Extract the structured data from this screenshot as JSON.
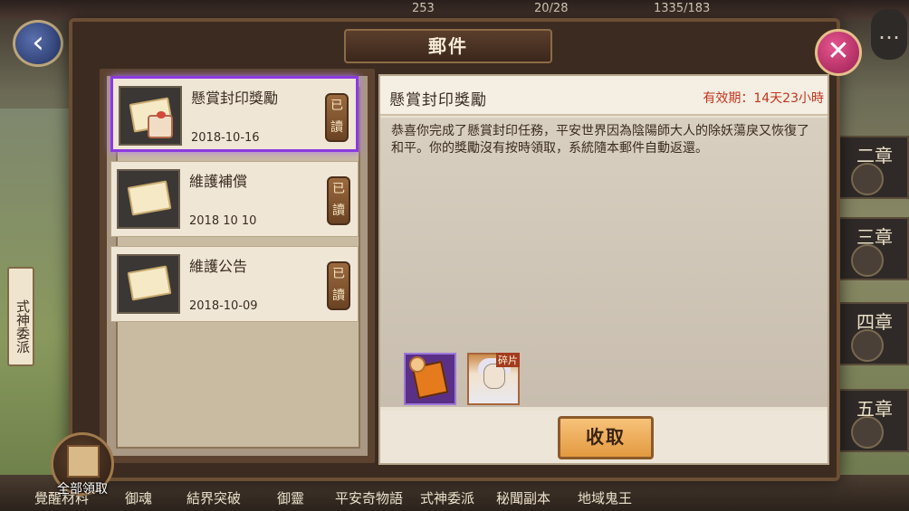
{
  "modal": {
    "title": "郵件",
    "close_icon": "close-icon"
  },
  "mail_list": [
    {
      "title": "懸賞封印獎勵",
      "date": "2018-10-16",
      "status": [
        "已",
        "讀"
      ],
      "icon": "gift-envelope-icon",
      "selected": true
    },
    {
      "title": "維護補償",
      "date": "2018 10 10",
      "status": [
        "已",
        "讀"
      ],
      "icon": "envelope-icon",
      "selected": false
    },
    {
      "title": "維護公告",
      "date": "2018-10-09",
      "status": [
        "已",
        "讀"
      ],
      "icon": "envelope-icon",
      "selected": false
    }
  ],
  "detail": {
    "title": "懸賞封印獎勵",
    "validity": "有效期：14天23小時",
    "body": "恭喜你完成了懸賞封印任務，平安世界因為陰陽師大人的除妖蕩戾又恢復了和平。你的獎勵沒有按時領取，系統隨本郵件自動返還。",
    "rewards": [
      {
        "icon": "talisman-card-icon"
      },
      {
        "icon": "shikigami-fragment-icon",
        "badge": "碎片"
      }
    ],
    "claim_label": "收取"
  },
  "claim_all": {
    "label": "全部領取"
  },
  "background": {
    "left_banner": "式神委派",
    "chapters": [
      "二章",
      "三章",
      "四章",
      "五章"
    ],
    "bottom_nav": [
      "覺醒材料",
      "御魂",
      "結界突破",
      "御靈",
      "平安奇物語",
      "式神委派",
      "秘聞副本",
      "地域鬼王"
    ],
    "top_stats": [
      "253",
      "20/28",
      "1335/183"
    ]
  },
  "colors": {
    "selected_border": "#8b3be0",
    "validity_text": "#c2361e",
    "claim_button": "#e39a40",
    "close_button": "#c02e6c"
  }
}
